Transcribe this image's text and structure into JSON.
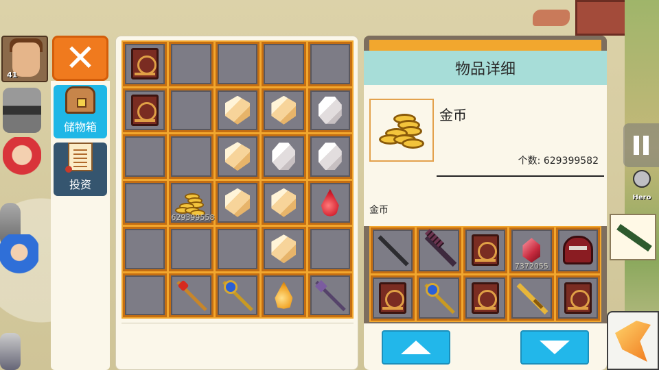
{
  "hud": {
    "player_level": "41",
    "hero_label": "Hero"
  },
  "menu": {
    "close_glyph": "✕",
    "tabs": [
      {
        "label": "储物箱",
        "icon": "chest-icon",
        "active": true
      },
      {
        "label": "投资",
        "icon": "scroll-icon",
        "active": false
      }
    ]
  },
  "storage": {
    "slots": [
      {
        "icon": "spellbook"
      },
      {
        "icon": ""
      },
      {
        "icon": ""
      },
      {
        "icon": ""
      },
      {
        "icon": ""
      },
      {
        "icon": "spellbook"
      },
      {
        "icon": ""
      },
      {
        "icon": "gold-crystal"
      },
      {
        "icon": "gold-crystal"
      },
      {
        "icon": "white-gem"
      },
      {
        "icon": ""
      },
      {
        "icon": ""
      },
      {
        "icon": "gold-crystal"
      },
      {
        "icon": "white-gem"
      },
      {
        "icon": "white-gem"
      },
      {
        "icon": ""
      },
      {
        "icon": "gold-coins",
        "qty": "629399558"
      },
      {
        "icon": "gold-crystal"
      },
      {
        "icon": "gold-crystal"
      },
      {
        "icon": "red-potion-drop"
      },
      {
        "icon": ""
      },
      {
        "icon": ""
      },
      {
        "icon": ""
      },
      {
        "icon": "gold-crystal"
      },
      {
        "icon": ""
      },
      {
        "icon": ""
      },
      {
        "icon": "red-staff"
      },
      {
        "icon": "blue-orb-staff"
      },
      {
        "icon": "amber-drop"
      },
      {
        "icon": "dark-staff"
      }
    ]
  },
  "detail": {
    "title": "物品详细",
    "item_name": "金币",
    "count_label": "个数: 629399582",
    "description": "金币"
  },
  "bag": {
    "slots": [
      {
        "icon": "dark-sword"
      },
      {
        "icon": "black-spear"
      },
      {
        "icon": "spellbook"
      },
      {
        "icon": "red-gem",
        "qty": "7372055"
      },
      {
        "icon": "red-helmet"
      },
      {
        "icon": "spellbook"
      },
      {
        "icon": "blue-orb-staff"
      },
      {
        "icon": "spellbook"
      },
      {
        "icon": "gold-sword"
      },
      {
        "icon": "spellbook"
      }
    ]
  },
  "colors": {
    "orange": "#f07a1e",
    "cyan": "#22b7ea",
    "grid_border": "#f2a72e",
    "header_teal": "#a7ddd8"
  }
}
